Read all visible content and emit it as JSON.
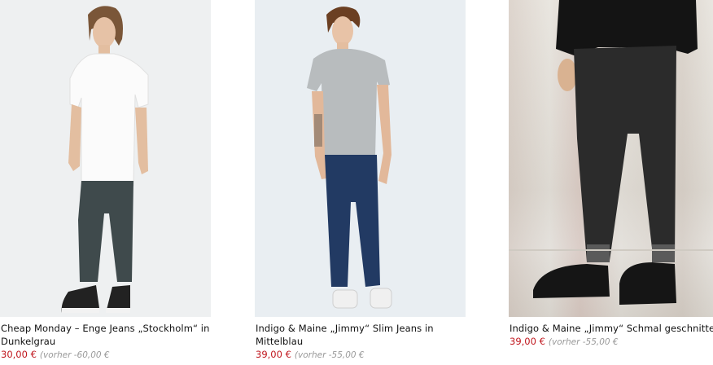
{
  "products": [
    {
      "title": "Cheap Monday – Enge Jeans „Stockholm“ in Dunkelgrau",
      "price": "30,00 €",
      "previous_price": "(vorher -60,00 €"
    },
    {
      "title": "Indigo & Maine „Jimmy“ Slim Jeans in Mittelblau",
      "price": "39,00 €",
      "previous_price": "(vorher -55,00 €"
    },
    {
      "title": "Indigo & Maine „Jimmy“ Schmal geschnittene Jeans in abgetragenem Schwarz",
      "price": "39,00 €",
      "previous_price": "(vorher -55,00 €"
    }
  ],
  "colors": {
    "price": "#c0161d",
    "previous_price": "#999999",
    "title": "#111111"
  }
}
